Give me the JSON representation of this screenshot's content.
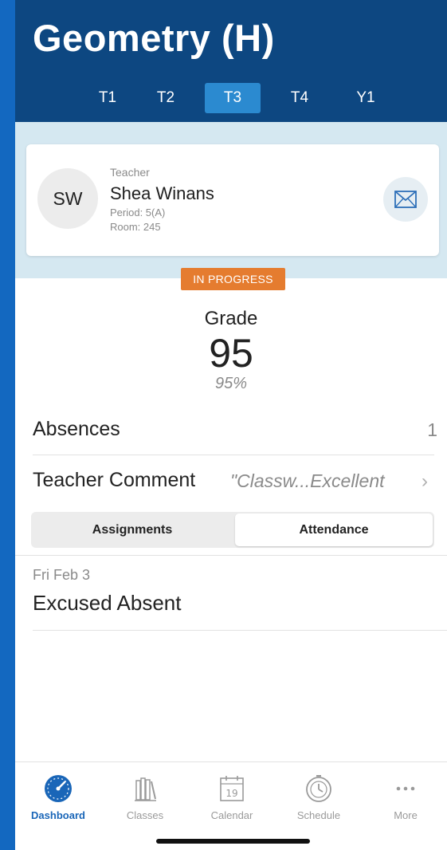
{
  "header": {
    "title": "Geometry (H)",
    "tabs": [
      {
        "label": "T1",
        "active": false
      },
      {
        "label": "T2",
        "active": false
      },
      {
        "label": "T3",
        "active": true
      },
      {
        "label": "T4",
        "active": false
      },
      {
        "label": "Y1",
        "active": false
      }
    ]
  },
  "teacher": {
    "initials": "SW",
    "role": "Teacher",
    "name": "Shea Winans",
    "period": "Period: 5(A)",
    "room": "Room: 245",
    "contact_icon": "mail-icon"
  },
  "status_badge": "IN PROGRESS",
  "grade": {
    "label": "Grade",
    "value": "95",
    "percent": "95%"
  },
  "absences": {
    "label": "Absences",
    "value": "1"
  },
  "comment": {
    "label": "Teacher Comment",
    "value": "\"Classw...Excellent",
    "chevron": "›"
  },
  "segments": [
    {
      "label": "Assignments",
      "selected": false
    },
    {
      "label": "Attendance",
      "selected": true
    }
  ],
  "attendance_entries": [
    {
      "date": "Fri Feb 3",
      "status": "Excused Absent"
    }
  ],
  "tabbar": [
    {
      "label": "Dashboard",
      "icon": "dashboard-icon",
      "active": true
    },
    {
      "label": "Classes",
      "icon": "classes-icon",
      "active": false
    },
    {
      "label": "Calendar",
      "icon": "calendar-icon",
      "active": false,
      "day": "19"
    },
    {
      "label": "Schedule",
      "icon": "schedule-icon",
      "active": false
    },
    {
      "label": "More",
      "icon": "more-icon",
      "active": false
    }
  ],
  "colors": {
    "header_bg": "#0d4781",
    "tab_active": "#2b8ad0",
    "badge": "#e57c2f",
    "accent": "#1a66b8",
    "outer_bg": "#1368c0"
  }
}
